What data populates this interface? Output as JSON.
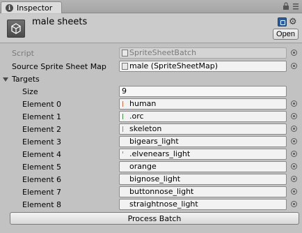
{
  "tab": {
    "label": "Inspector",
    "icon": "info-icon"
  },
  "header": {
    "title": "male sheets",
    "open_label": "Open"
  },
  "script": {
    "label": "Script",
    "value": "SpriteSheetBatch"
  },
  "source": {
    "label": "Source Sprite Sheet Map",
    "value": "male (SpriteSheetMap)"
  },
  "targets": {
    "label": "Targets",
    "size_label": "Size",
    "size_value": "9",
    "elements": [
      {
        "label": "Element 0",
        "value": "human"
      },
      {
        "label": "Element 1",
        "value": ".orc"
      },
      {
        "label": "Element 2",
        "value": "skeleton"
      },
      {
        "label": "Element 3",
        "value": "bigears_light"
      },
      {
        "label": "Element 4",
        "value": ".elvenears_light"
      },
      {
        "label": "Element 5",
        "value": "orange"
      },
      {
        "label": "Element 6",
        "value": "bignose_light"
      },
      {
        "label": "Element 7",
        "value": "buttonnose_light"
      },
      {
        "label": "Element 8",
        "value": "straightnose_light"
      }
    ]
  },
  "process_button": "Process Batch",
  "colors": {
    "background": "#c2c2c2",
    "field": "#f2f2f2",
    "accent": "#2f5c9a"
  }
}
